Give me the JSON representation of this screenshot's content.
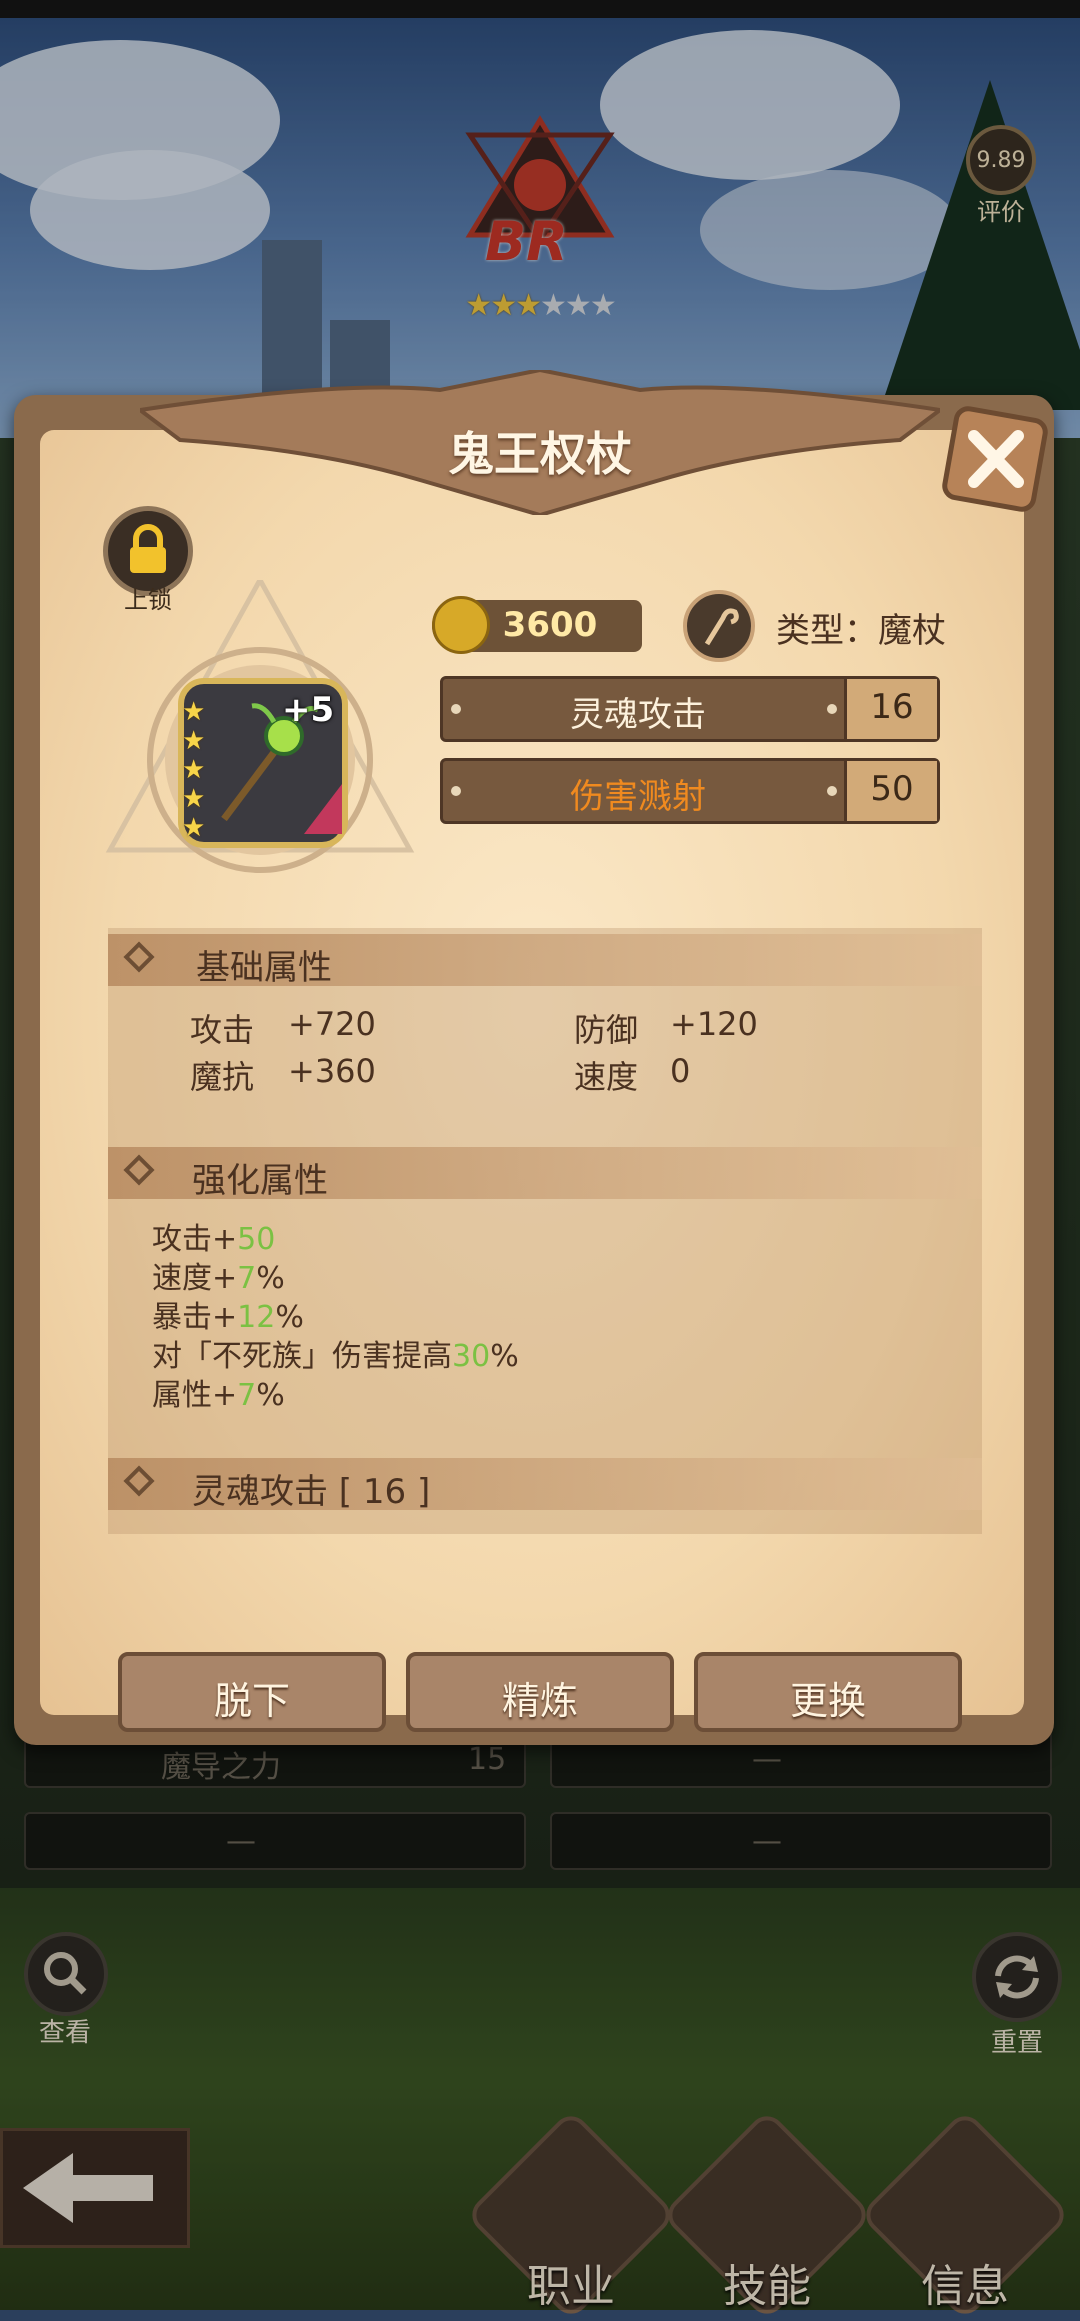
{
  "header": {
    "rank_text": "BR",
    "stars_filled": 3,
    "stars_total": 6,
    "score_value": "9.89",
    "score_label": "评价"
  },
  "background_rows": [
    {
      "label": "魔导之力",
      "value": "15"
    },
    {
      "label": "—",
      "value": ""
    },
    {
      "label": "—",
      "value": ""
    },
    {
      "label": "—",
      "value": ""
    }
  ],
  "dialog": {
    "title": "鬼王权杖",
    "lock_label": "上锁",
    "item": {
      "plus": "+5",
      "stars": 5
    },
    "power": "3600",
    "type_label": "类型：魔杖",
    "skills": [
      {
        "label": "灵魂攻击",
        "value": "16",
        "highlight": false
      },
      {
        "label": "伤害溅射",
        "value": "50",
        "highlight": true
      }
    ],
    "base_section": {
      "title": "基础属性",
      "attrs": [
        {
          "name": "攻击",
          "value": "+720"
        },
        {
          "name": "防御",
          "value": "+120"
        },
        {
          "name": "魔抗",
          "value": "+360"
        },
        {
          "name": "速度",
          "value": "0"
        }
      ]
    },
    "enhance_section": {
      "title": "强化属性",
      "lines": [
        {
          "prefix": "攻击+",
          "num": "50",
          "suffix": ""
        },
        {
          "prefix": "速度+",
          "num": "7",
          "suffix": "%"
        },
        {
          "prefix": "暴击+",
          "num": "12",
          "suffix": "%"
        },
        {
          "prefix": "对「不死族」伤害提高",
          "num": "30",
          "suffix": "%"
        },
        {
          "prefix": "属性+",
          "num": "7",
          "suffix": "%"
        }
      ]
    },
    "skill_section": {
      "title": "灵魂攻击 [ 16 ]"
    },
    "buttons": {
      "unequip": "脱下",
      "refine": "精炼",
      "replace": "更换"
    }
  },
  "bottom": {
    "search_label": "查看",
    "reset_label": "重置",
    "tabs": [
      "职业",
      "技能",
      "信息"
    ]
  },
  "colors": {
    "accent_green": "#7bc143",
    "highlight_orange": "#f08a1f",
    "parchment": "#f3d8ad"
  }
}
